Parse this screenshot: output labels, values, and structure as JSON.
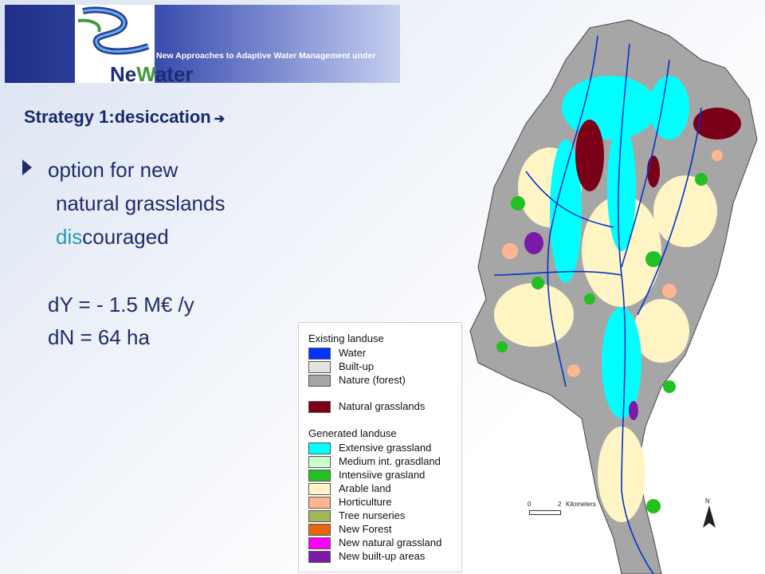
{
  "header": {
    "tagline": "New Approaches to Adaptive Water Management under",
    "logo_prefix": "Ne",
    "logo_w": "W",
    "logo_suffix": "ater"
  },
  "content": {
    "strategy_title": "Strategy 1:desiccation",
    "strategy_arrow": "➔",
    "bullet_line1": "option for new",
    "bullet_line2": "natural grasslands",
    "discouraged_prefix": "dis",
    "discouraged_rest": "couraged",
    "dy": "dY = - 1.5 M€ /y",
    "dn": "dN =  64 ha"
  },
  "legend": {
    "existing_title": "Existing landuse",
    "generated_title": "Generated landuse",
    "existing": [
      {
        "label": "Water",
        "color": "#0033ff"
      },
      {
        "label": "Built-up",
        "color": "#e2e2e2"
      },
      {
        "label": "Nature (forest)",
        "color": "#a6a6a6"
      },
      {
        "label": "Natural grasslands",
        "color": "#7a0018"
      }
    ],
    "generated": [
      {
        "label": "Extensive grassland",
        "color": "#00ffff"
      },
      {
        "label": "Medium int. grasdland",
        "color": "#c9ffcf"
      },
      {
        "label": "Intensiive grasland",
        "color": "#22c022"
      },
      {
        "label": "Arable land",
        "color": "#fff5c4"
      },
      {
        "label": "Horticulture",
        "color": "#ffb690"
      },
      {
        "label": "Tree nurseries",
        "color": "#a4b858"
      },
      {
        "label": "New Forest",
        "color": "#e86410"
      },
      {
        "label": "New natural grassland",
        "color": "#ff00ff"
      },
      {
        "label": "New built-up areas",
        "color": "#7a1aa6"
      }
    ]
  },
  "map": {
    "scale_0": "0",
    "scale_2": "2",
    "scale_unit": "Kilometers",
    "north": "N"
  },
  "colors": {
    "accent_title": "#162a6b",
    "teal": "#1e9eb0"
  }
}
